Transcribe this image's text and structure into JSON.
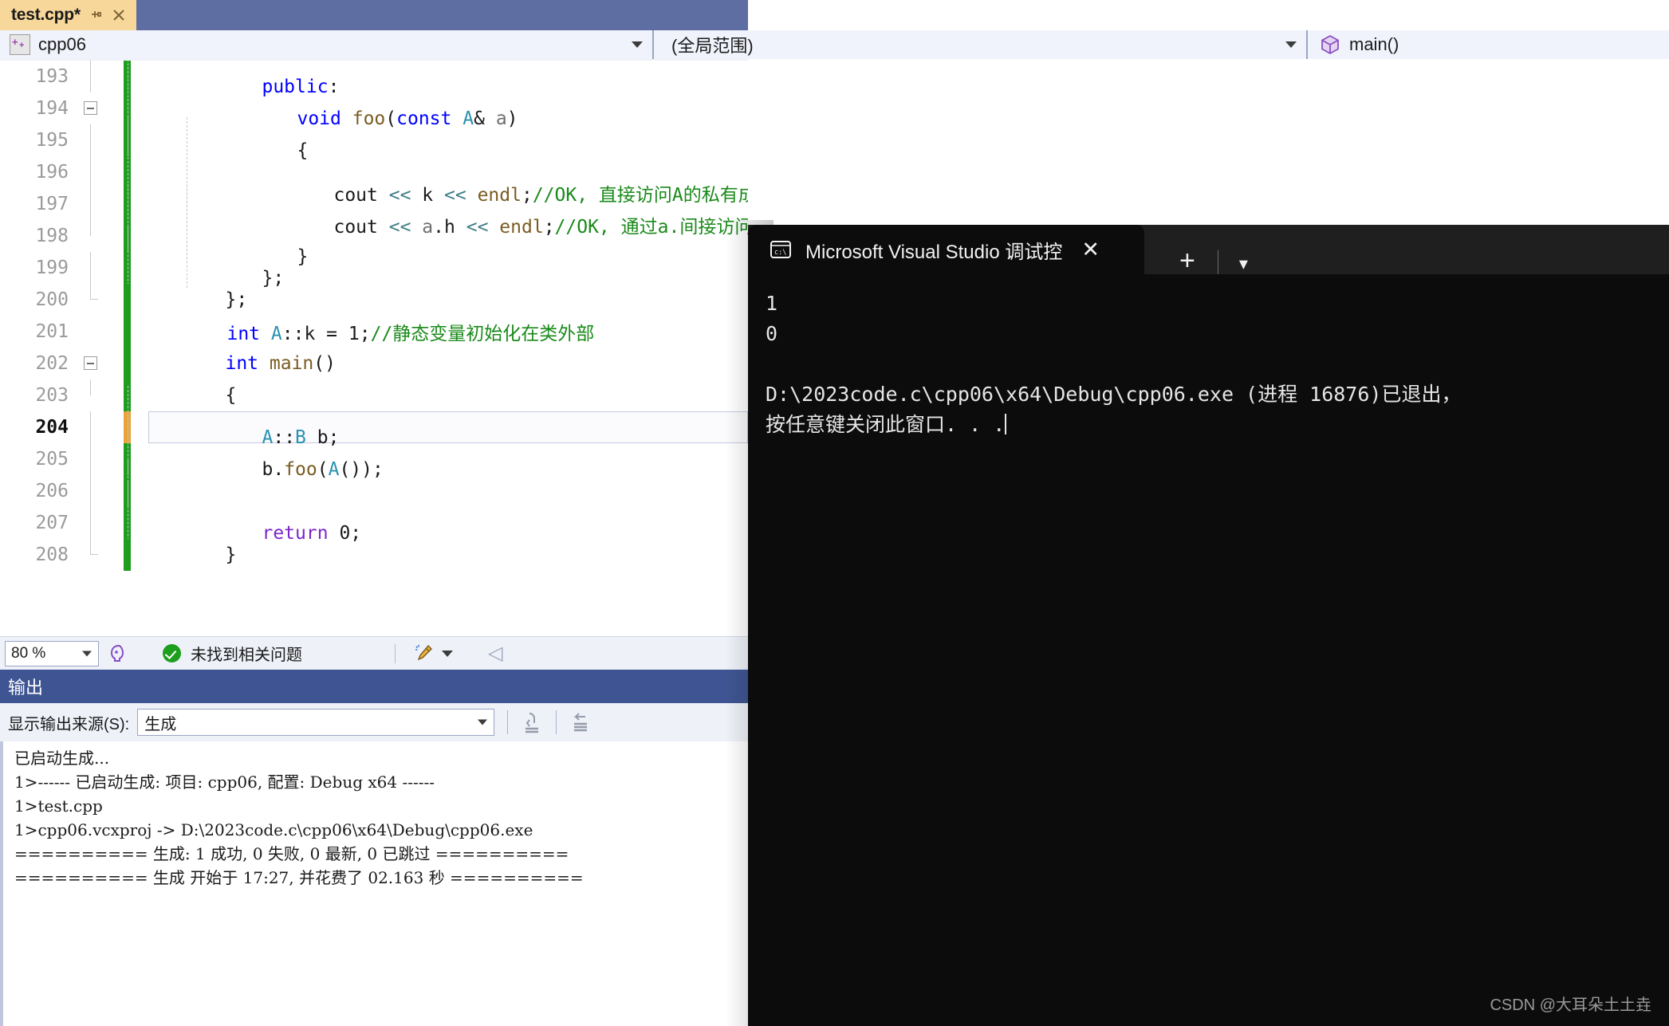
{
  "tab": {
    "title": "test.cpp*",
    "pin_icon": "pin-icon",
    "close_icon": "close-icon"
  },
  "navbar": {
    "project": "cpp06",
    "scope": "(全局范围)",
    "member": "main()",
    "project_icon": "cpp-file-icon",
    "member_icon": "cube-icon"
  },
  "editor": {
    "lines": [
      {
        "no": "193",
        "text": "public:"
      },
      {
        "no": "194",
        "text": "    void foo(const A& a)"
      },
      {
        "no": "195",
        "text": "    {"
      },
      {
        "no": "196",
        "text": "        cout << k << endl;//OK, 直接访问A的私有成员"
      },
      {
        "no": "197",
        "text": "        cout << a.h << endl;//OK, 通过a.间接访问A的私有成员"
      },
      {
        "no": "198",
        "text": "    }"
      },
      {
        "no": "199",
        "text": "};"
      },
      {
        "no": "200",
        "text": "};"
      },
      {
        "no": "201",
        "text": "int A::k = 1;//静态变量初始化在类外部"
      },
      {
        "no": "202",
        "text": "int main()"
      },
      {
        "no": "203",
        "text": "{"
      },
      {
        "no": "204",
        "text": "A::B b;"
      },
      {
        "no": "205",
        "text": "b.foo(A());"
      },
      {
        "no": "206",
        "text": ""
      },
      {
        "no": "207",
        "text": "return 0;"
      },
      {
        "no": "208",
        "text": "}"
      }
    ],
    "current_line": "204"
  },
  "status": {
    "zoom": "80 %",
    "intellisense_icon": "intellisense-icon",
    "problems_icon": "check-circle-icon",
    "problems_text": "未找到相关问题",
    "cleanup_icon": "broom-icon",
    "collapse_icon": "chevron-left-icon"
  },
  "output": {
    "title": "输出",
    "source_label": "显示输出来源(S):",
    "source_value": "生成",
    "toolbar_icons": [
      "jump-to-line-icon",
      "word-wrap-icon"
    ],
    "log": [
      "已启动生成...",
      "1>------ 已启动生成: 项目: cpp06, 配置: Debug x64 ------",
      "1>test.cpp",
      "1>cpp06.vcxproj -> D:\\2023code.c\\cpp06\\x64\\Debug\\cpp06.exe",
      "========== 生成: 1 成功, 0 失败, 0 最新, 0 已跳过 ==========",
      "========== 生成 开始于 17:27, 并花费了 02.163 秒 =========="
    ]
  },
  "terminal": {
    "tab_title": "Microsoft Visual Studio 调试控",
    "tab_icon": "cmd-prompt-icon",
    "close_icon": "close-icon",
    "new_tab_icon": "plus-icon",
    "dropdown_icon": "chevron-down-icon",
    "lines": [
      "1",
      "0",
      "",
      "D:\\2023code.c\\cpp06\\x64\\Debug\\cpp06.exe (进程 16876)已退出，",
      "按任意键关闭此窗口. . ."
    ],
    "watermark": "CSDN @大耳朵土土垚"
  },
  "colors": {
    "tab_active_bg": "#f7d79a",
    "tabstrip_bg": "#5e6ea2",
    "output_header_bg": "#3f5593",
    "keyword": "#0000ff",
    "comment": "#1a8a1a",
    "type": "#2b91af",
    "function": "#7a5c22",
    "control": "#7c26c9",
    "saved_marker": "#1e9e1e",
    "edit_marker": "#e8a33d",
    "terminal_bg": "#0c0c0c"
  }
}
